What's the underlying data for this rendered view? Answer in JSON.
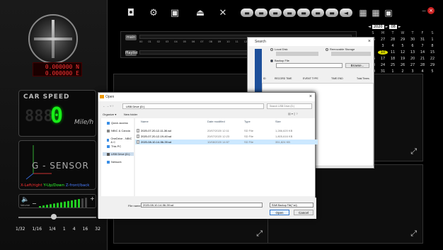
{
  "left_panel": {
    "coord_lat": "0.000000 N",
    "coord_lon": "0.000000 E",
    "speed_title": "CAR SPEED",
    "speed_ghost": "888",
    "speed_value": "0",
    "speed_unit": "Mile/h",
    "gsensor_title": "G - SENSOR",
    "gsensor_legend": {
      "x": "X-Left/right",
      "y": "Y-Up/Down",
      "z": "Z-front/back"
    },
    "volume_label": "Volume",
    "speed_ticks": [
      "1/32",
      "1/16",
      "1/4",
      "1",
      "4",
      "16",
      "32"
    ],
    "colors": {
      "x": "#ff3030",
      "y": "#30ff30",
      "z": "#4a7dff"
    }
  },
  "toolbar": {
    "icons": [
      "camera-icon",
      "settings-gear-icon",
      "save-icon",
      "eject-icon",
      "tools-icon"
    ],
    "pill_glyphs": [
      "▬",
      "▬",
      "▬",
      "▬",
      "▬",
      "▬",
      "▬",
      "◄"
    ]
  },
  "timeline": {
    "row1_label": "main",
    "row2_label": "Playlist",
    "ticks": [
      "00",
      "01",
      "02",
      "03",
      "04",
      "05",
      "06",
      "07",
      "08",
      "09",
      "10",
      "11",
      "12",
      "13",
      "14",
      "15",
      "16",
      "17",
      "18",
      "19",
      "20",
      "21",
      "22",
      "23",
      "24"
    ]
  },
  "calendar": {
    "year": "2020",
    "month": "08",
    "weekdays": [
      "S",
      "M",
      "T",
      "W",
      "T",
      "F",
      "S"
    ],
    "days": [
      "26",
      "27",
      "28",
      "29",
      "30",
      "31",
      "1",
      "2",
      "3",
      "4",
      "5",
      "6",
      "7",
      "8",
      "9",
      "10",
      "11",
      "12",
      "13",
      "14",
      "15",
      "16",
      "17",
      "18",
      "19",
      "20",
      "21",
      "22",
      "23",
      "24",
      "25",
      "26",
      "27",
      "28",
      "29",
      "30",
      "31",
      "1",
      "2",
      "3",
      "4",
      "5"
    ],
    "selected_day": "10"
  },
  "search_dialog": {
    "title": "Search",
    "local_disk": "Local Disk",
    "removable": "Removable Storage",
    "backup_file": "Backup File",
    "browse": "Browse...",
    "columns": [
      "ID",
      "RECORD TIME",
      "EVENT TYPE",
      "TIME END",
      "Total Times"
    ]
  },
  "open_dialog": {
    "title": "Open",
    "path": "USB Drive (D:)",
    "search_placeholder": "Search USB Drive (D:)",
    "organize": "Organize ▾",
    "new_folder": "New folder",
    "sidebar": [
      "Quick access",
      "NBIC & Cancia",
      "OneDrive - NBIC & C",
      "This PC",
      "USB Drive (D:)",
      "Network"
    ],
    "columns": [
      "Name",
      "Date modified",
      "Type",
      "Size"
    ],
    "files": [
      {
        "name": "2020-07-20-12-11-36.sd",
        "date": "20/07/2020 12:11",
        "type": "SD File",
        "size": "1,286,620 KB"
      },
      {
        "name": "2020-07-20-12-19-40.sd",
        "date": "20/07/2020 12:23",
        "type": "SD File",
        "size": "1,805,616 KB"
      },
      {
        "name": "2020-08-10-14-56-39.sd",
        "date": "10/08/2020 14:57",
        "type": "SD File",
        "size": "351,824 KB"
      }
    ],
    "filename_label": "File name:",
    "filename_value": "2020-08-10-14-56-39.sd",
    "filetype_value": "RAW Backup File(*.sd)",
    "open_btn": "Open",
    "cancel_btn": "Cancel"
  }
}
